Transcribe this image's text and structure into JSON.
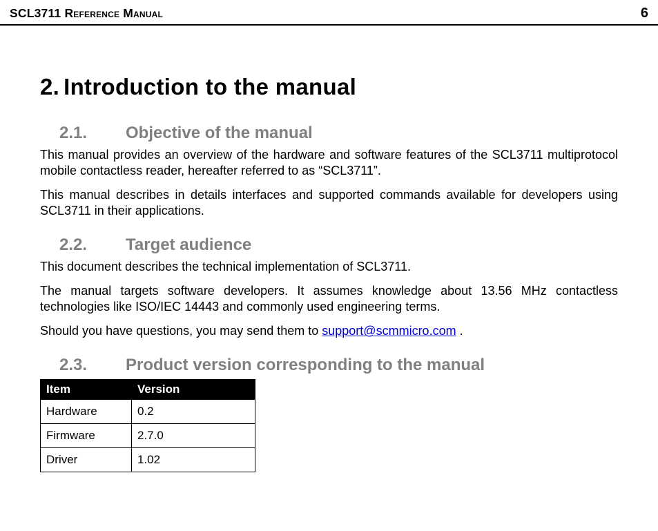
{
  "header": {
    "title_prefix": "SCL3711 ",
    "title_caps": "Reference Manual",
    "page_number": "6"
  },
  "chapter": {
    "number": "2.",
    "title": "Introduction to the manual"
  },
  "sections": [
    {
      "number": "2.1.",
      "title": "Objective of the manual",
      "paragraphs": [
        "This manual provides an overview of the hardware and software features of the SCL3711 multiprotocol mobile contactless reader, hereafter referred to as “SCL3711”.",
        "This manual describes in details interfaces and supported commands available for developers using SCL3711 in their applications."
      ]
    },
    {
      "number": "2.2.",
      "title": "Target audience",
      "paragraphs": [
        "This document describes the technical implementation of SCL3711.",
        "The manual targets software developers. It assumes knowledge about 13.56 MHz contactless technologies like ISO/IEC 14443 and commonly used engineering terms."
      ],
      "contact_prefix": "Should you have questions, you may send them to ",
      "contact_email": "support@scmmicro.com",
      "contact_suffix": " ."
    },
    {
      "number": "2.3.",
      "title": "Product version corresponding to the manual"
    }
  ],
  "version_table": {
    "headers": [
      "Item",
      "Version"
    ],
    "rows": [
      {
        "item": "Hardware",
        "version": "0.2"
      },
      {
        "item": "Firmware",
        "version": "2.7.0"
      },
      {
        "item": "Driver",
        "version": "1.02"
      }
    ]
  },
  "chart_data": {
    "type": "table",
    "columns": [
      "Item",
      "Version"
    ],
    "rows": [
      [
        "Hardware",
        "0.2"
      ],
      [
        "Firmware",
        "2.7.0"
      ],
      [
        "Driver",
        "1.02"
      ]
    ]
  }
}
